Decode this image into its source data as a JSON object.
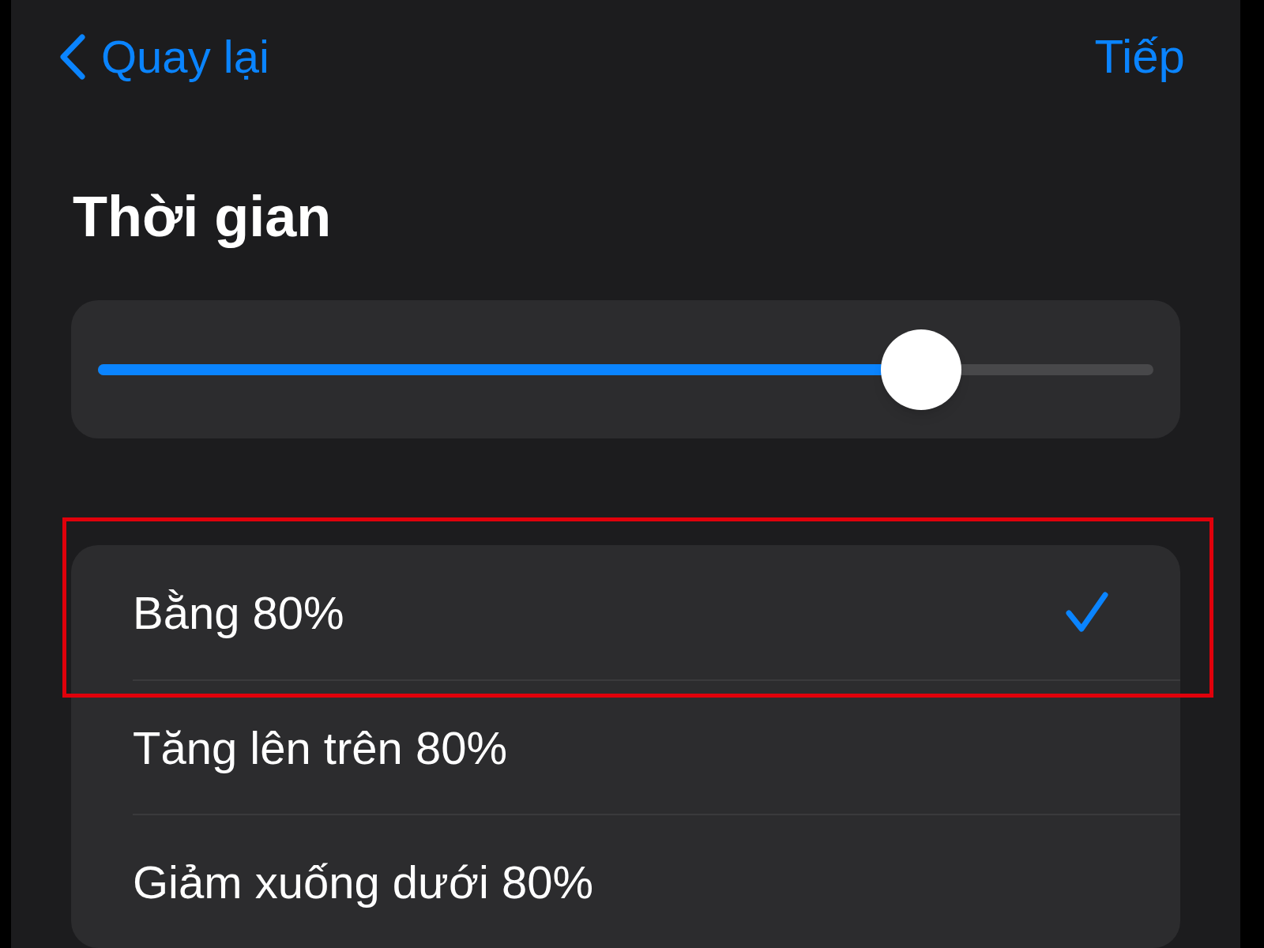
{
  "nav": {
    "back": "Quay lại",
    "next": "Tiếp"
  },
  "title": "Thời gian",
  "slider": {
    "level": 0.78
  },
  "options": [
    {
      "label": "Bằng 80%",
      "selected": true
    },
    {
      "label": "Tăng lên trên 80%",
      "selected": false
    },
    {
      "label": "Giảm xuống dưới 80%",
      "selected": false
    }
  ]
}
